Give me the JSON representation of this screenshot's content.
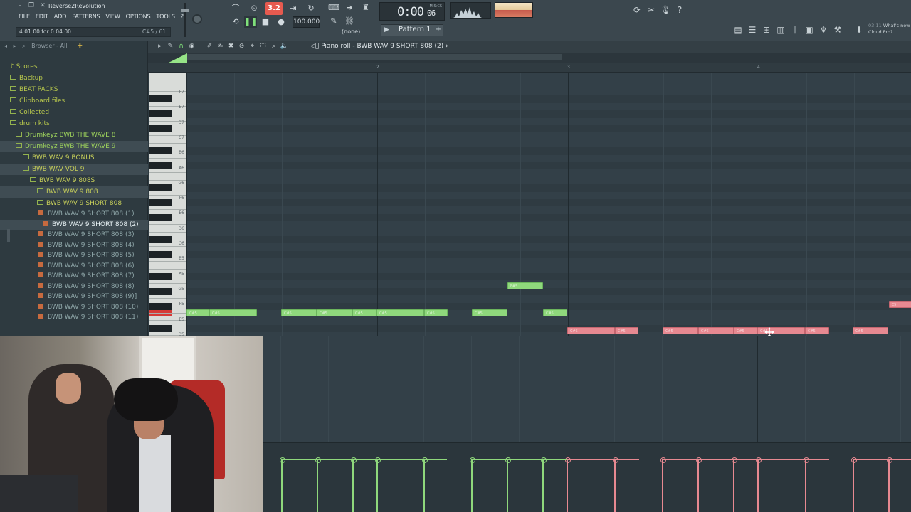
{
  "app": {
    "project_name": "Reverse2Revolution",
    "menu": [
      "FILE",
      "EDIT",
      "ADD",
      "PATTERNS",
      "VIEW",
      "OPTIONS",
      "TOOLS",
      "?"
    ],
    "hint": "4:01:00 for 0:04:00",
    "hint_right": "C#5 / 61"
  },
  "transport": {
    "tempo_display": "3.2",
    "tempo": "100.000",
    "snap": "(none)",
    "time": "0:00",
    "time_small": "06",
    "time_unit": "M:S:CS",
    "pattern": "Pattern 1"
  },
  "news": {
    "time": "03:11",
    "text1": "What's new",
    "text2": "Cloud Pro?"
  },
  "browser": {
    "header": "Browser - All",
    "items": [
      {
        "label": "Scores",
        "type": "folder",
        "level": 0
      },
      {
        "label": "Backup",
        "type": "folder",
        "level": 0
      },
      {
        "label": "BEAT PACKS",
        "type": "folder",
        "level": 0
      },
      {
        "label": "Clipboard files",
        "type": "folder",
        "level": 0
      },
      {
        "label": "Collected",
        "type": "folder",
        "level": 0
      },
      {
        "label": "drum kits",
        "type": "folder",
        "level": 0
      },
      {
        "label": "Drumkeyz BWB THE WAVE 8",
        "type": "folder",
        "level": 1
      },
      {
        "label": "Drumkeyz BWB THE WAVE 9",
        "type": "folder",
        "level": 1
      },
      {
        "label": "BWB WAV 9 BONUS",
        "type": "folder",
        "level": 2
      },
      {
        "label": "BWB WAV VOL 9",
        "type": "folder",
        "level": 2
      },
      {
        "label": "BWB WAV 9 808S",
        "type": "folder",
        "level": 3
      },
      {
        "label": "BWB WAV 9 808",
        "type": "folder",
        "level": 4
      },
      {
        "label": "BWB WAV 9 SHORT 808",
        "type": "folder",
        "level": 4
      },
      {
        "label": "BWB WAV 9 SHORT 808 (1)",
        "type": "file"
      },
      {
        "label": "BWB WAV 9 SHORT 808 (2)",
        "type": "file",
        "active": true
      },
      {
        "label": "BWB WAV 9 SHORT 808 (3)",
        "type": "file"
      },
      {
        "label": "BWB WAV 9 SHORT 808 (4)",
        "type": "file"
      },
      {
        "label": "BWB WAV 9 SHORT 808 (5)",
        "type": "file"
      },
      {
        "label": "BWB WAV 9 SHORT 808 (6)",
        "type": "file"
      },
      {
        "label": "BWB WAV 9 SHORT 808 (7)",
        "type": "file"
      },
      {
        "label": "BWB WAV 9 SHORT 808 (8)",
        "type": "file"
      },
      {
        "label": "BWB WAV 9 SHORT 808 (9)]",
        "type": "file"
      },
      {
        "label": "BWB WAV 9 SHORT 808 (10)",
        "type": "file"
      },
      {
        "label": "BWB WAV 9 SHORT 808 (11)",
        "type": "file"
      }
    ]
  },
  "piano_roll": {
    "title": "Piano roll - BWB WAV 9 SHORT 808 (2)",
    "bar_numbers": [
      "2",
      "3",
      "4"
    ],
    "key_labels": [
      "F7",
      "E7",
      "D7",
      "C7",
      "B6",
      "A6",
      "G6",
      "F6",
      "E6",
      "D6",
      "C6",
      "B5",
      "A5",
      "G5",
      "F5",
      "E5",
      "D5"
    ],
    "green_note_label": "C#5",
    "high_note_label": "F#5",
    "red_note_label": "C#5",
    "far_note_label": "E5"
  },
  "colors": {
    "green_note": "#8fd87c",
    "red_note": "#e78991",
    "active_key": "#d63a36",
    "grid_bg": "#334048"
  }
}
